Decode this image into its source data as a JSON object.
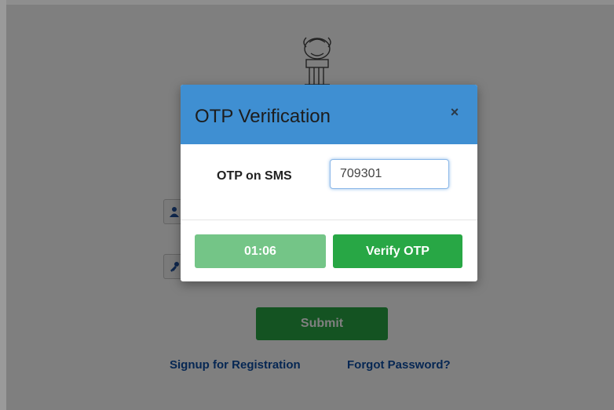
{
  "modal": {
    "title": "OTP Verification",
    "close_label": "×",
    "otp_label": "OTP on SMS",
    "otp_value": "709301",
    "timer_label": "01:06",
    "verify_label": "Verify OTP"
  },
  "background_page": {
    "submit_label": "Submit",
    "signup_link": "Signup for Registration",
    "forgot_link": "Forgot Password?",
    "emblem_icon": "state-emblem-icon",
    "user_icon": "user-icon",
    "password_icon": "key-icon"
  },
  "colors": {
    "modal_header": "#3f8fd2",
    "verify_button": "#28a745",
    "timer_button": "#74c587",
    "link": "#0d4ea6"
  }
}
